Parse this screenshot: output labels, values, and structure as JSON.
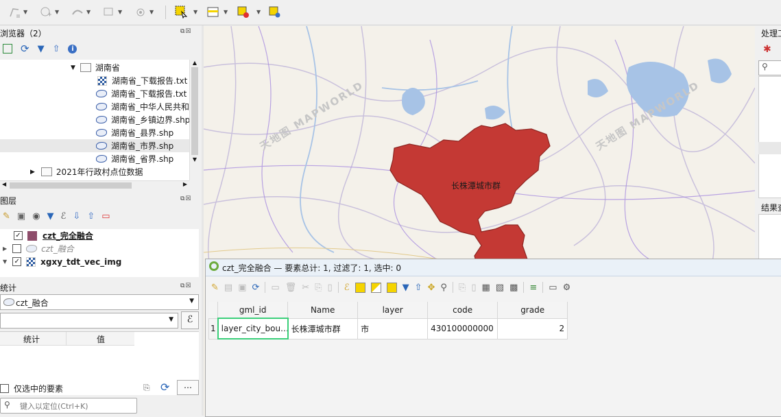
{
  "toolbar": {
    "icons": [
      "digitize-icon",
      "add-point-icon",
      "add-line-icon",
      "add-polygon-icon",
      "vertex-icon",
      "select-rect-icon",
      "attribute-table-icon",
      "deselect-icon",
      "identify-icon"
    ]
  },
  "browser": {
    "title": "浏览器（2）",
    "tree": [
      {
        "label": "湖南省",
        "type": "folder",
        "expanded": true
      },
      {
        "label": "湖南省_下载报告.txt",
        "type": "txt"
      },
      {
        "label": "湖南省_下载报告.txt",
        "type": "shp"
      },
      {
        "label": "湖南省_中华人民共和",
        "type": "shp"
      },
      {
        "label": "湖南省_乡镇边界.shp",
        "type": "shp"
      },
      {
        "label": "湖南省_县界.shp",
        "type": "shp"
      },
      {
        "label": "湖南省_市界.shp",
        "type": "shp"
      },
      {
        "label": "湖南省_省界.shp",
        "type": "shp"
      },
      {
        "label": "2021年行政村点位数据",
        "type": "folder",
        "expanded": false
      }
    ]
  },
  "layers": {
    "title": "图层",
    "items": [
      {
        "label": "czt_完全融合",
        "checked": true,
        "style": "bold-underline",
        "swatch": "#8e4d6b"
      },
      {
        "label": "czt_融合",
        "checked": false,
        "style": "italic-gray"
      },
      {
        "label": "xgxy_tdt_vec_img",
        "checked": true,
        "style": "bold"
      }
    ]
  },
  "stats": {
    "title": "统计",
    "layer_select": "czt_融合",
    "field_value": "",
    "col_stat": "统计",
    "col_value": "值",
    "selected_only": "仅选中的要素",
    "more_button": "…"
  },
  "locator": {
    "placeholder": "键入以定位(Ctrl+K)"
  },
  "processing": {
    "title": "处理工",
    "results_title": "结果查"
  },
  "map": {
    "region_label": "长株潭城市群",
    "watermark": "天地图 MAPWORLD",
    "fill_color": "#c43934"
  },
  "attribute_table": {
    "window_title": "czt_完全融合 — 要素总计: 1, 过滤了: 1, 选中: 0",
    "columns": [
      "gml_id",
      "Name",
      "layer",
      "code",
      "grade"
    ],
    "rows": [
      {
        "num": "1",
        "gml_id": "layer_city_bou…",
        "Name": "长株潭城市群",
        "layer": "市",
        "code": "430100000000",
        "grade": "2"
      }
    ]
  }
}
